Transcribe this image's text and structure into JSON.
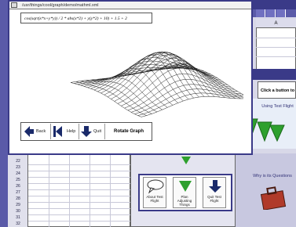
{
  "main_window": {
    "title": "/usr/things/cool/graph/demo/mathml.xml",
    "equation": "cos(sqrt(x*x+y*y)) / 2 * abs(x*2) + y(y*2) + 10) + 1.5 + 2"
  },
  "nav": {
    "back_label": "Back",
    "help_label": "Help",
    "quit_label": "Quit",
    "rotate_label": "Rotate Graph"
  },
  "right_panel": {
    "column_header": "A",
    "click_label": "Click a button to",
    "using_text": "Using Test Flight",
    "middle_text": "Why is its Questions"
  },
  "tutorial": {
    "buttons": [
      {
        "label": "About Test Flight",
        "icon": "speech-bubble-icon"
      },
      {
        "label": "Plan Adjusting Things",
        "icon": "green-triangle-icon"
      },
      {
        "label": "Quit Test Flight",
        "icon": "down-arrow-icon"
      }
    ]
  },
  "spreadsheet": {
    "rows": [
      "22",
      "23",
      "24",
      "25",
      "26",
      "27",
      "28",
      "29",
      "30",
      "31",
      "32"
    ]
  },
  "colors": {
    "accent": "#3a3a88",
    "green": "#2ea02e",
    "navy": "#1a2a6a"
  }
}
